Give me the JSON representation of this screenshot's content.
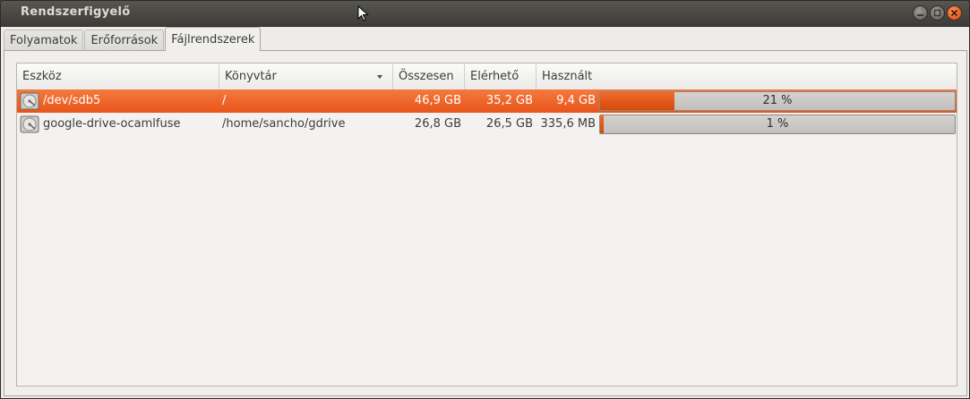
{
  "window": {
    "title": "Rendszerfigyelő"
  },
  "tabs": [
    {
      "label": "Folyamatok",
      "active": false
    },
    {
      "label": "Erőforrások",
      "active": false
    },
    {
      "label": "Fájlrendszerek",
      "active": true
    }
  ],
  "columns": [
    "Eszköz",
    "Könyvtár",
    "Összesen",
    "Elérhető",
    "Használt"
  ],
  "rows": [
    {
      "device": "/dev/sdb5",
      "directory": "/",
      "total": "46,9 GB",
      "available": "35,2 GB",
      "used": "9,4 GB",
      "percent_label": "21 %",
      "used_fraction": 0.21,
      "selected": true,
      "icon": "hard-disk-icon"
    },
    {
      "device": "google-drive-ocamlfuse",
      "directory": "/home/sancho/gdrive",
      "total": "26,8 GB",
      "available": "26,5 GB",
      "used": "335,6 MB",
      "percent_label": "1 %",
      "used_fraction": 0.01,
      "selected": false,
      "icon": "hard-disk-icon"
    }
  ],
  "colors": {
    "selection": "#e8541a",
    "titlebar": "#3d3c37",
    "progress_fill": "#e0561a"
  }
}
